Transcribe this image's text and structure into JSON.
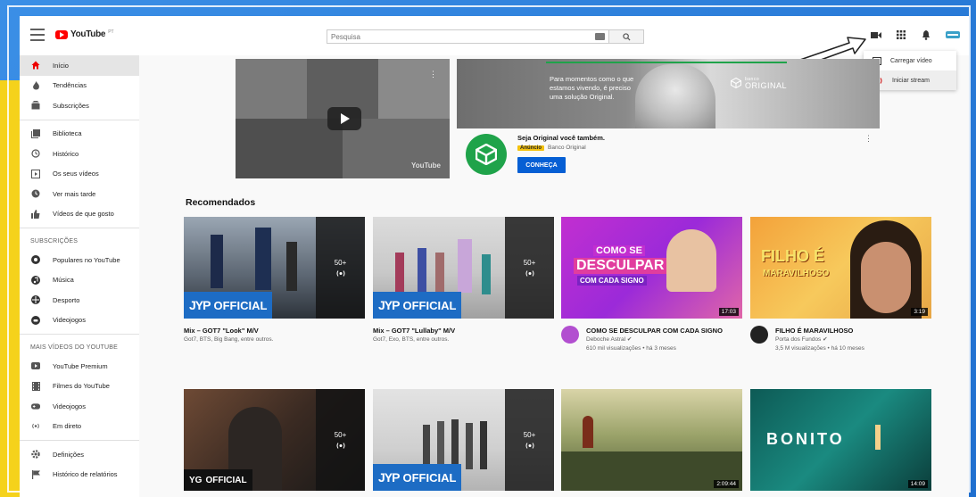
{
  "header": {
    "logo_text": "YouTube",
    "logo_sup": "PT",
    "search_placeholder": "Pesquisa"
  },
  "upload_menu": {
    "items": [
      "Carregar vídeo",
      "Iniciar stream"
    ]
  },
  "sidebar": {
    "main": [
      "Início",
      "Tendências",
      "Subscrições"
    ],
    "library": [
      "Biblioteca",
      "Histórico",
      "Os seus vídeos",
      "Ver mais tarde",
      "Vídeos de que gosto"
    ],
    "subs_heading": "SUBSCRIÇÕES",
    "subs": [
      "Populares no YouTube",
      "Música",
      "Desporto",
      "Videojogos"
    ],
    "more_heading": "MAIS VÍDEOS DO YOUTUBE",
    "more": [
      "YouTube Premium",
      "Filmes do YouTube",
      "Videojogos",
      "Em direto"
    ],
    "settings": [
      "Definições",
      "Histórico de relatórios"
    ]
  },
  "ad": {
    "left_watermark": "YouTube",
    "banner_text": "Para momentos como o que estamos vivendo, é preciso uma solução Original.",
    "banner_brand": "ORIGINAL",
    "banner_brand_small": "banco",
    "title": "Seja Original você também.",
    "badge": "Anúncio",
    "advertiser": "Banco Original",
    "cta": "CONHEÇA"
  },
  "section_title": "Recomendados",
  "videos": [
    {
      "title": "Mix – GOT7 \"Look\" M/V",
      "sub1": "Got7, BTS, Big Bang, entre outros.",
      "playlist_count": "50+",
      "badge": "OFFICIAL",
      "badge_prefix": "JYP"
    },
    {
      "title": "Mix – GOT7 \"Lullaby\" M/V",
      "sub1": "Got7, Exo, BTS, entre outros.",
      "playlist_count": "50+",
      "badge": "OFFICIAL",
      "badge_prefix": "JYP"
    },
    {
      "title": "COMO SE DESCULPAR COM CADA SIGNO",
      "channel": "Deboche Astral",
      "stats": "610 mil visualizações • há 3 meses",
      "duration": "17:03",
      "thumb_line1": "COMO SE",
      "thumb_line2": "DESCULPAR",
      "thumb_line3": "COM CADA SIGNO"
    },
    {
      "title": "FILHO É MARAVILHOSO",
      "channel": "Porta dos Fundos",
      "stats": "3,5 M visualizações • há 10 meses",
      "duration": "3:19",
      "thumb_line1": "FILHO É",
      "thumb_line2": "MARAVILHOSO"
    },
    {
      "playlist_count": "50+",
      "badge": "OFFICIAL",
      "badge_prefix": "YG"
    },
    {
      "playlist_count": "50+",
      "badge": "OFFICIAL",
      "badge_prefix": "JYP"
    },
    {
      "duration": "2:09:44"
    },
    {
      "duration": "14:09",
      "thumb_title": "BONITO"
    }
  ],
  "colors": {
    "accent_red": "#ff0000",
    "ad_green": "#1fa34a",
    "cta_blue": "#065fd4",
    "badge_blue": "#1d6cc4"
  }
}
